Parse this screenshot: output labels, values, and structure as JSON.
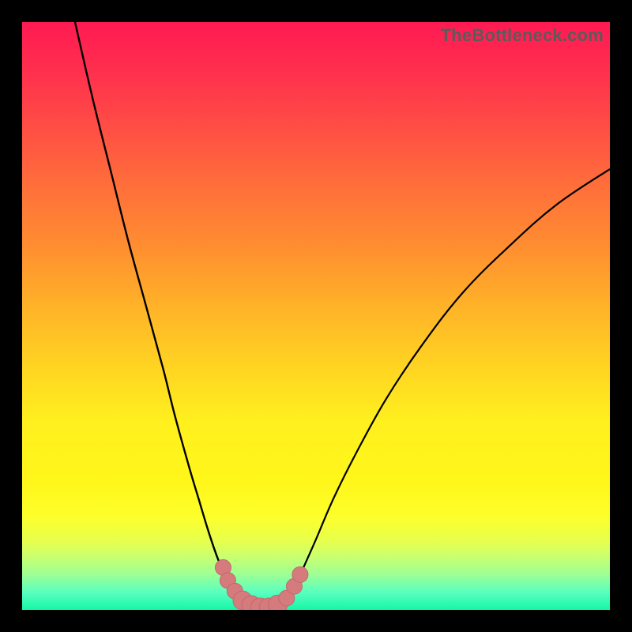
{
  "watermark": "TheBottleneck.com",
  "chart_data": {
    "type": "line",
    "title": "",
    "xlabel": "",
    "ylabel": "",
    "xlim": [
      0,
      100
    ],
    "ylim": [
      0,
      100
    ],
    "grid": false,
    "series": [
      {
        "name": "left-curve",
        "x": [
          9,
          12,
          15,
          18,
          21,
          24,
          26,
          28.5,
          30,
          31.5,
          33,
          34,
          35,
          36,
          37,
          38,
          39,
          40,
          41
        ],
        "y": [
          100,
          87,
          75,
          63,
          52,
          41,
          33,
          24,
          19,
          14,
          9.5,
          7,
          5,
          3.7,
          2.6,
          1.8,
          1.1,
          0.6,
          0.2
        ]
      },
      {
        "name": "right-curve",
        "x": [
          43,
          44,
          45,
          46.5,
          48,
          50,
          53,
          57,
          62,
          68,
          75,
          83,
          91,
          100
        ],
        "y": [
          0.2,
          0.8,
          2.0,
          4.2,
          7.5,
          12,
          19,
          27,
          36,
          45,
          54,
          62,
          69,
          75
        ]
      },
      {
        "name": "basin",
        "x": [
          36,
          37.5,
          38.5,
          39.5,
          40.5,
          41.5,
          42.5,
          43.5,
          45,
          46.2,
          47
        ],
        "y": [
          3.7,
          2.4,
          1.5,
          0.8,
          0.4,
          0.2,
          0.4,
          0.9,
          2.0,
          3.6,
          5.4
        ]
      }
    ],
    "markers": [
      {
        "x": 34.2,
        "y": 7.2,
        "r": 10
      },
      {
        "x": 35.0,
        "y": 5.0,
        "r": 10
      },
      {
        "x": 36.2,
        "y": 3.2,
        "r": 10
      },
      {
        "x": 37.5,
        "y": 1.6,
        "r": 12
      },
      {
        "x": 39.0,
        "y": 0.8,
        "r": 12
      },
      {
        "x": 40.5,
        "y": 0.4,
        "r": 12
      },
      {
        "x": 42.0,
        "y": 0.4,
        "r": 12
      },
      {
        "x": 43.5,
        "y": 0.9,
        "r": 12
      },
      {
        "x": 45.0,
        "y": 2.0,
        "r": 10
      },
      {
        "x": 46.3,
        "y": 4.0,
        "r": 10
      },
      {
        "x": 47.3,
        "y": 6.0,
        "r": 10
      }
    ]
  }
}
